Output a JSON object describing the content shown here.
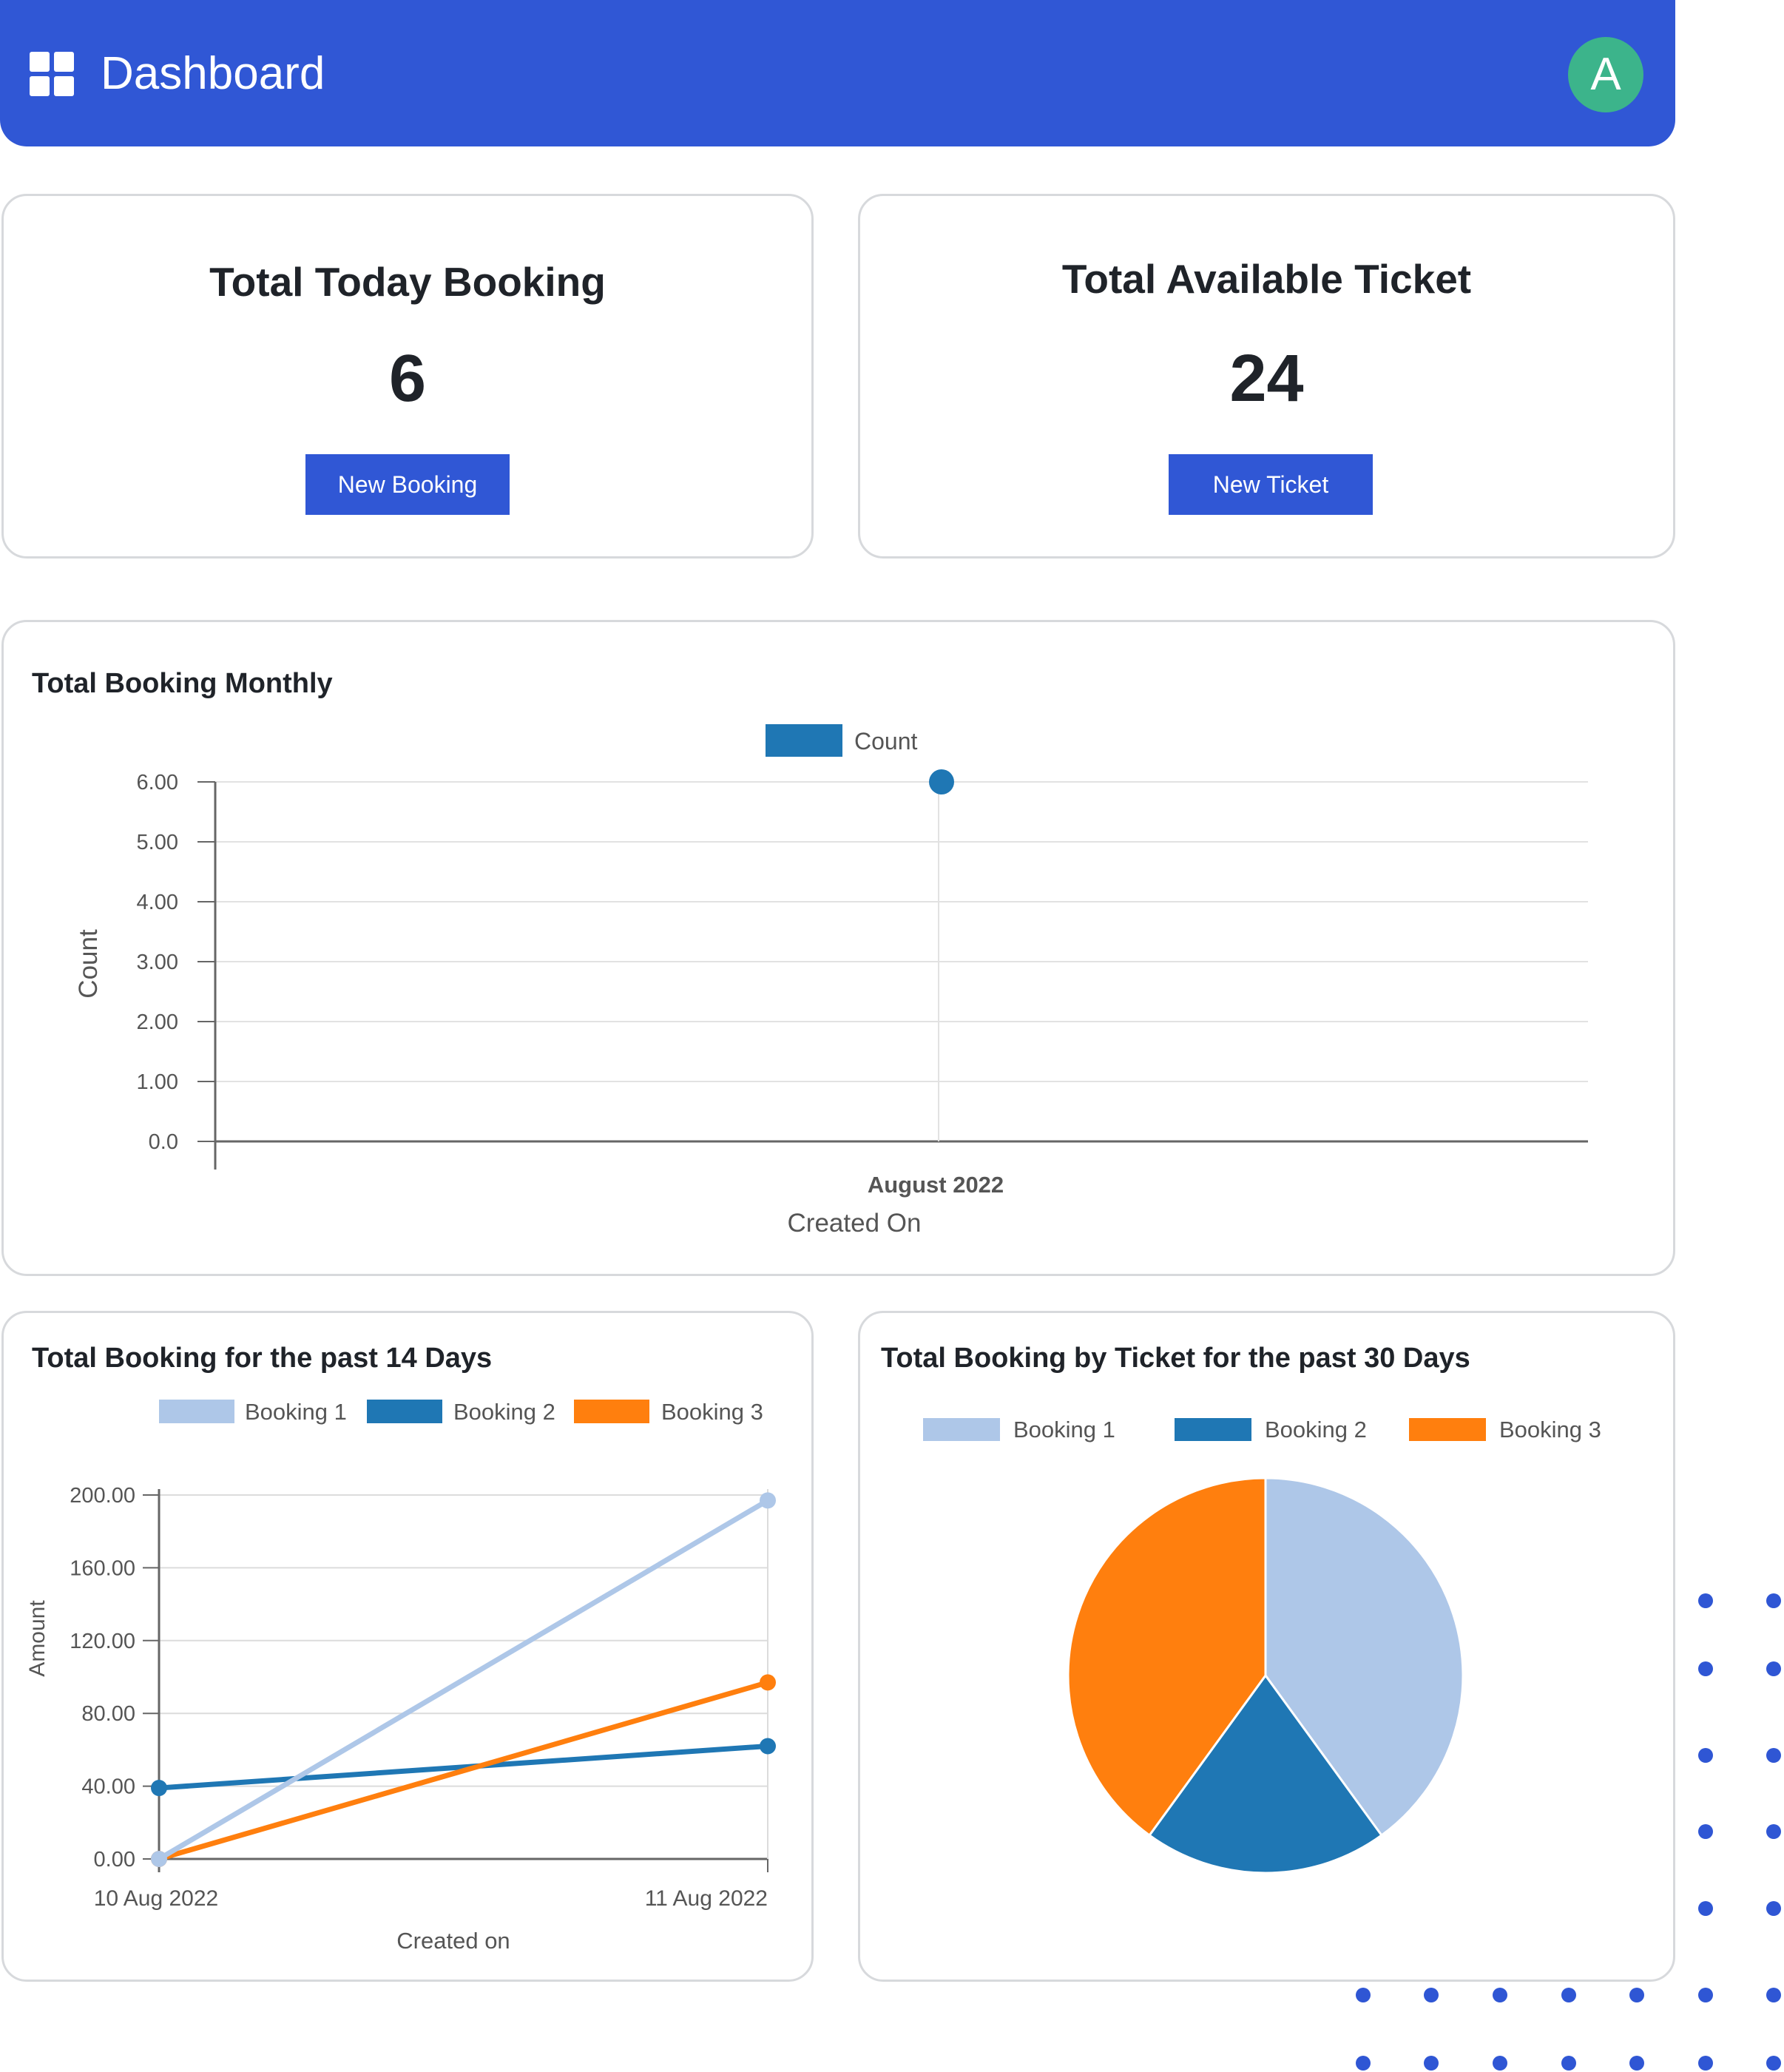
{
  "header": {
    "title": "Dashboard",
    "avatar_letter": "A",
    "icon": "grid-icon"
  },
  "stats": [
    {
      "title": "Total Today Booking",
      "value": "6",
      "button_label": "New Booking"
    },
    {
      "title": "Total Available Ticket",
      "value": "24",
      "button_label": "New Ticket"
    }
  ],
  "colors": {
    "primary": "#3057d5",
    "avatar": "#3cb48b",
    "booking1": "#aec7e8",
    "booking2": "#1f77b4",
    "booking3": "#ff7f0e"
  },
  "chart_data": [
    {
      "type": "scatter",
      "title": "Total Booking Monthly",
      "categories": [
        "August 2022"
      ],
      "series": [
        {
          "name": "Count",
          "values": [
            6
          ]
        }
      ],
      "xlabel": "Created On",
      "ylabel": "Count",
      "ylim": [
        0,
        6
      ],
      "yticks": [
        "0.0",
        "1.00",
        "2.00",
        "3.00",
        "4.00",
        "5.00",
        "6.00"
      ],
      "grid": true,
      "legend": "top-center"
    },
    {
      "type": "line",
      "title": "Total Booking for the past 14 Days",
      "categories": [
        "10 Aug 2022",
        "11 Aug 2022"
      ],
      "series": [
        {
          "name": "Booking 1",
          "values": [
            0,
            197
          ]
        },
        {
          "name": "Booking 2",
          "values": [
            39,
            62
          ]
        },
        {
          "name": "Booking 3",
          "values": [
            0,
            97
          ]
        }
      ],
      "xlabel": "Created on",
      "ylabel": "Amount",
      "ylim": [
        0,
        200
      ],
      "yticks": [
        "0.00",
        "40.00",
        "80.00",
        "120.00",
        "160.00",
        "200.00"
      ],
      "grid": true,
      "legend": "top-center"
    },
    {
      "type": "pie",
      "title": "Total Booking by Ticket for the past 30 Days",
      "categories": [
        "Booking 1",
        "Booking 2",
        "Booking 3"
      ],
      "values": [
        40,
        20,
        40
      ],
      "legend": "top-center"
    }
  ]
}
